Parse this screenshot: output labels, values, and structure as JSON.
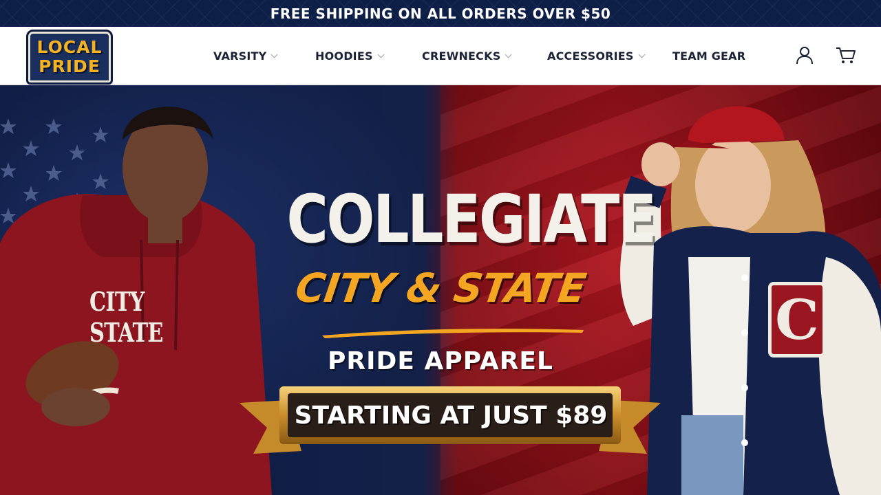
{
  "announcement": {
    "text": "FREE SHIPPING ON ALL ORDERS OVER $50"
  },
  "logo": {
    "line1": "LOCAL",
    "line2": "PRIDE"
  },
  "nav": {
    "items": [
      {
        "label": "VARSITY",
        "has_dropdown": true
      },
      {
        "label": "HOODIES",
        "has_dropdown": true
      },
      {
        "label": "CREWNECKS",
        "has_dropdown": true
      },
      {
        "label": "ACCESSORIES",
        "has_dropdown": true
      },
      {
        "label": "TEAM GEAR",
        "has_dropdown": false
      }
    ],
    "account_icon": "user-icon",
    "cart_icon": "cart-icon"
  },
  "hero": {
    "headline": "COLLEGIATE",
    "script_line": "CITY & STATE",
    "subline": "PRIDE APPAREL",
    "price_banner": "STARTING AT JUST $89",
    "hoodie_text": "CITY STATE",
    "jacket_letter": "C"
  },
  "colors": {
    "navy": "#0f1e4a",
    "crimson": "#a3131c",
    "gold": "#f4a623",
    "logo_gold": "#f4b324"
  }
}
